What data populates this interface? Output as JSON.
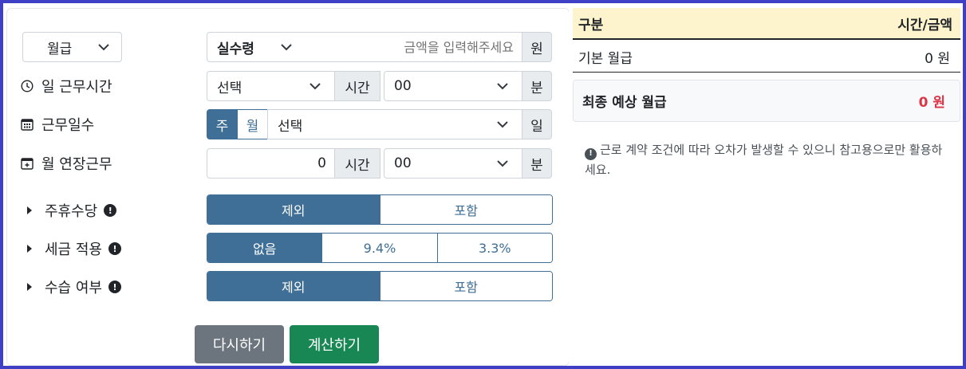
{
  "form": {
    "pay_type": "월급",
    "amount_mode": "실수령",
    "amount_placeholder": "금액을 입력해주세요",
    "amount_unit": "원",
    "daily_hours_label": "일 근무시간",
    "daily_hours_select": "선택",
    "hours_addon": "시간",
    "daily_minutes_select": "00",
    "minutes_addon": "분",
    "workdays_label": "근무일수",
    "workdays_toggle_week": "주",
    "workdays_toggle_month": "월",
    "workdays_select": "선택",
    "days_addon": "일",
    "overtime_label": "월 연장근무",
    "overtime_hours_value": "0",
    "overtime_hours_addon": "시간",
    "overtime_minutes_select": "00",
    "overtime_minutes_addon": "분",
    "holiday_pay_label": "주휴수당",
    "holiday_pay_options": [
      "제외",
      "포함"
    ],
    "tax_label": "세금 적용",
    "tax_options": [
      "없음",
      "9.4%",
      "3.3%"
    ],
    "probation_label": "수습 여부",
    "probation_options": [
      "제외",
      "포함"
    ],
    "reset_button": "다시하기",
    "calc_button": "계산하기"
  },
  "result": {
    "header_col1": "구분",
    "header_col2": "시간/금액",
    "base_label": "기본 월급",
    "base_value": "0 원",
    "final_label": "최종 예상 월급",
    "final_value": "0 원",
    "notice": "근로 계약 조건에 따라 오차가 발생할 수 있으니 참고용으로만 활용하세요."
  },
  "colors": {
    "frame": "#3f3fc5",
    "segment_active": "#3f6f96",
    "reset_button": "#6c757d",
    "calc_button": "#198754",
    "header_bg": "#fdf3cc",
    "final_value": "#dc3545"
  }
}
